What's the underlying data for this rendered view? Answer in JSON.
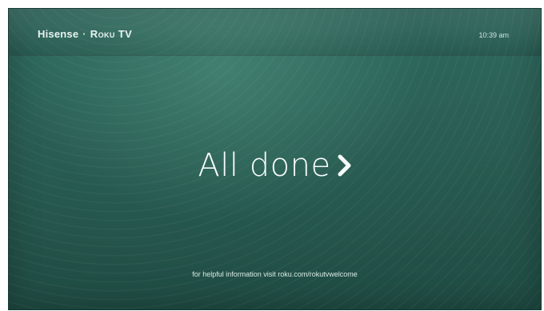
{
  "header": {
    "brand_primary": "Hisense",
    "brand_separator": "·",
    "brand_secondary": "Roku TV",
    "time": "10:39 am"
  },
  "main": {
    "cta_label": "All done",
    "cta_icon": "chevron-right-icon"
  },
  "footer": {
    "info_text": "for helpful information visit roku.com/rokutvwelcome"
  },
  "colors": {
    "background": "#2a5a52",
    "text": "#f6fbfa"
  }
}
